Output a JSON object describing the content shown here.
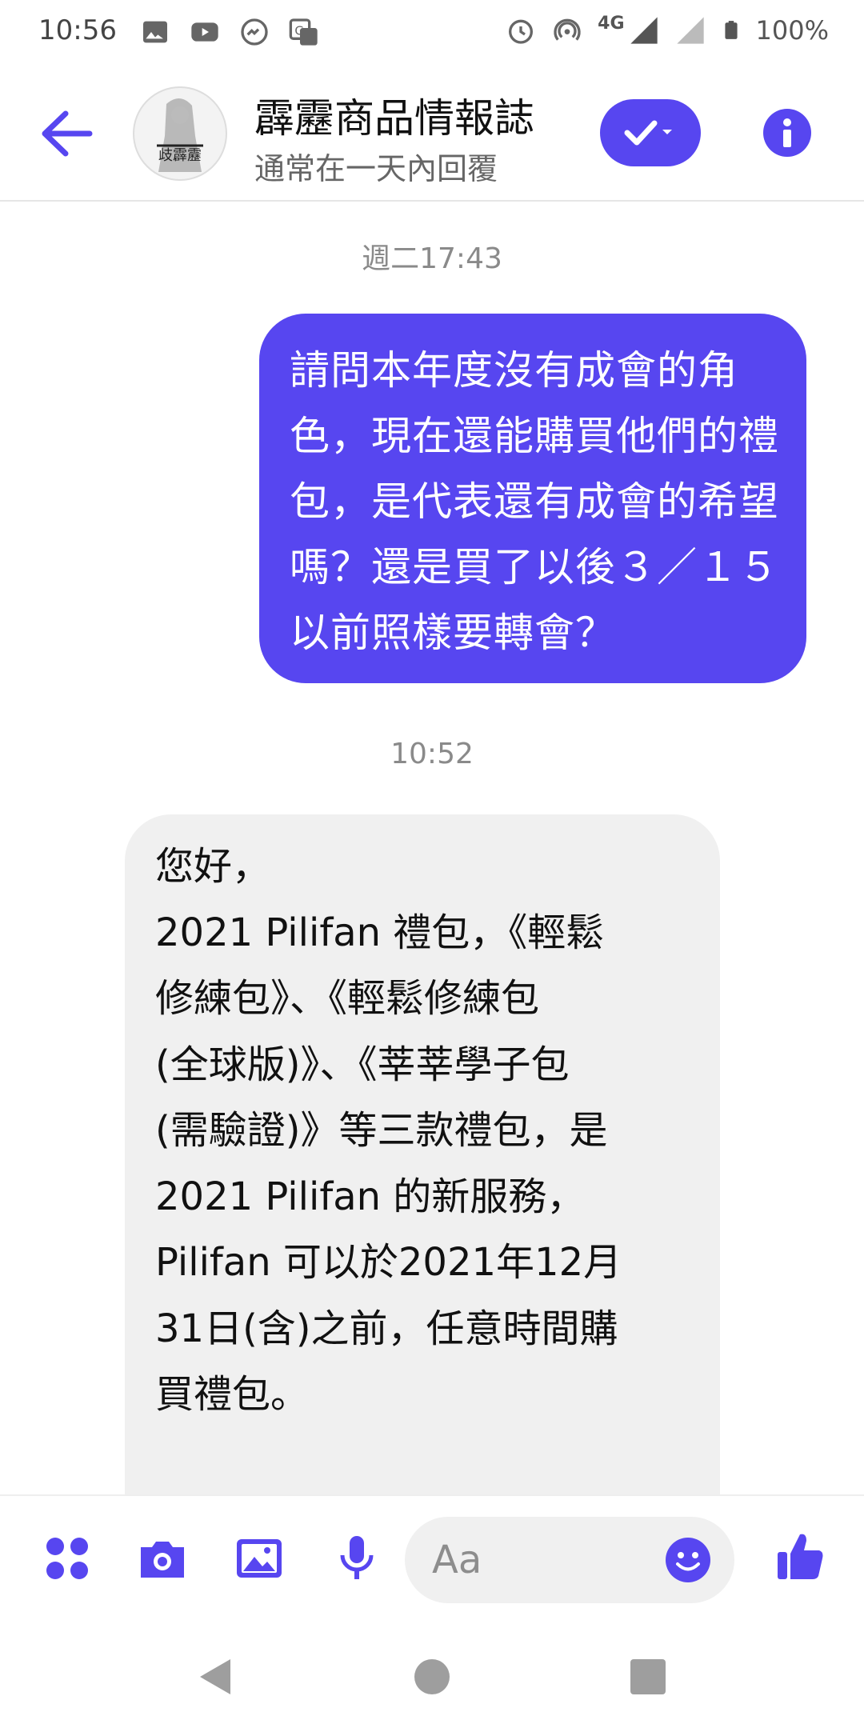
{
  "status_bar": {
    "time": "10:56",
    "network": "4G",
    "battery": "100%"
  },
  "header": {
    "title": "霹靂商品情報誌",
    "subtitle": "通常在一天內回覆",
    "accent_color": "#5746f0"
  },
  "chat": {
    "messages": [
      {
        "timestamp": "週二17:43"
      },
      {
        "direction": "outgoing",
        "text": "請問本年度沒有成會的角色，現在還能購買他們的禮包，是代表還有成會的希望嗎？還是買了以後３／１５以前照樣要轉會？"
      },
      {
        "timestamp": "10:52"
      },
      {
        "direction": "incoming",
        "text": "您好，\n2021 Pilifan 禮包，《輕鬆\n修練包》、《輕鬆修練包\n(全球版)》、《莘莘學子包\n(需驗證)》等三款禮包，是\n2021 Pilifan 的新服務，\nPilifan 可以於2021年12月\n31日(含)之前，任意時間購\n買禮包。"
      }
    ]
  },
  "composer": {
    "placeholder": "Aa"
  },
  "icons": {
    "status_left": [
      "image-icon",
      "youtube-icon",
      "messenger-icon",
      "translate-icon"
    ],
    "status_right": [
      "alarm-icon",
      "hotspot-icon",
      "signal-icon",
      "battery-icon"
    ],
    "composer_tools": [
      "apps-icon",
      "camera-icon",
      "gallery-icon",
      "microphone-icon",
      "emoji-icon",
      "thumbs-up-icon"
    ],
    "navbar": [
      "back-triangle-icon",
      "home-circle-icon",
      "recents-square-icon"
    ]
  }
}
